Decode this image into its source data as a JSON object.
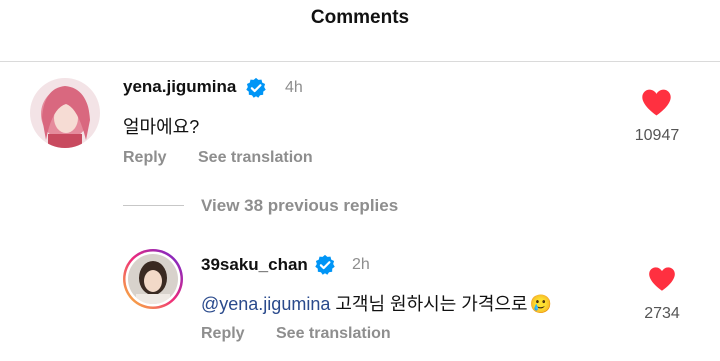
{
  "header": {
    "title": "Comments"
  },
  "comments": [
    {
      "username": "yena.jigumina",
      "time": "4h",
      "text": "얼마에요?",
      "reply_label": "Reply",
      "translate_label": "See translation",
      "likes": "10947"
    }
  ],
  "view_replies_label": "View 38 previous replies",
  "reply": {
    "username": "39saku_chan",
    "time": "2h",
    "mention": "@yena.jigumina",
    "text": " 고객님 원하시는 가격으로",
    "emoji": "🥲",
    "reply_label": "Reply",
    "translate_label": "See translation",
    "likes": "2734"
  },
  "colors": {
    "like_heart": "#ff3040",
    "verified_badge": "#0095f6",
    "story_ring_start": "#f9ce34",
    "story_ring_mid": "#ee2a7b",
    "story_ring_end": "#6228d7"
  }
}
